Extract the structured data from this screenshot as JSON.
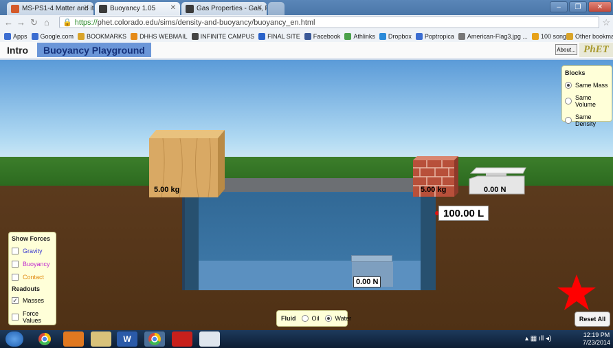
{
  "browser": {
    "tabs": [
      {
        "label": "MS-PS1-4 Matter and its I",
        "color": "#d45a2a"
      },
      {
        "label": "Buoyancy 1.05",
        "color": "#3b3b3b"
      },
      {
        "label": "Gas Properties - Gas, Press",
        "color": "#3b3b3b"
      }
    ],
    "url_https": "https://",
    "url_rest": "phet.colorado.edu/sims/density-and-buoyancy/buoyancy_en.html",
    "bookmarks": [
      {
        "label": "Apps",
        "color": "#3b6dd1"
      },
      {
        "label": "Google.com",
        "color": "#3b6dd1"
      },
      {
        "label": "BOOKMARKS",
        "color": "#d9a42a"
      },
      {
        "label": "DHHS WEBMAIL",
        "color": "#e58a18"
      },
      {
        "label": "INFINITE CAMPUS",
        "color": "#444444"
      },
      {
        "label": "FINAL SITE",
        "color": "#2a62c9"
      },
      {
        "label": "Facebook",
        "color": "#3b5998"
      },
      {
        "label": "Athlinks",
        "color": "#4aa04a"
      },
      {
        "label": "Dropbox",
        "color": "#2a8ad9"
      },
      {
        "label": "Poptropica",
        "color": "#3b6dd1"
      },
      {
        "label": "American-Flag3.jpg ...",
        "color": "#777777"
      },
      {
        "label": "100 song",
        "color": "#e6a11a"
      }
    ],
    "other_bookmarks": "Other bookmarks"
  },
  "sim": {
    "tab_intro": "Intro",
    "tab_playground": "Buoyancy Playground",
    "about": "About...",
    "logo": "PhET"
  },
  "scene": {
    "wood_mass": "5.00 kg",
    "brick_mass": "5.00 kg",
    "scale_top": "0.00 N",
    "scale_pool": "0.00 N",
    "pool_volume": "100.00 L"
  },
  "blocks_panel": {
    "title": "Blocks",
    "options": [
      {
        "label": "Same Mass",
        "selected": true
      },
      {
        "label": "Same Volume",
        "selected": false
      },
      {
        "label": "Same Density",
        "selected": false
      }
    ]
  },
  "forces_panel": {
    "title": "Show Forces",
    "items": [
      {
        "label": "Gravity",
        "checked": false,
        "color": "#3a3ad0"
      },
      {
        "label": "Buoyancy",
        "checked": false,
        "color": "#c02ad0"
      },
      {
        "label": "Contact",
        "checked": false,
        "color": "#e08a10"
      }
    ],
    "readouts_title": "Readouts",
    "readouts": [
      {
        "label": "Masses",
        "checked": true
      },
      {
        "label": "Force Values",
        "checked": false
      }
    ]
  },
  "fluid_panel": {
    "title": "Fluid",
    "options": [
      {
        "label": "Oil",
        "selected": false
      },
      {
        "label": "Water",
        "selected": true
      }
    ]
  },
  "reset_label": "Reset All",
  "taskbar": {
    "time": "12:19 PM",
    "date": "7/23/2014"
  },
  "colors": {
    "highlight_star": "#ff0000",
    "sky": "#5b9bd8",
    "grass": "#3c7e2b",
    "water": "#2f6b9c"
  }
}
